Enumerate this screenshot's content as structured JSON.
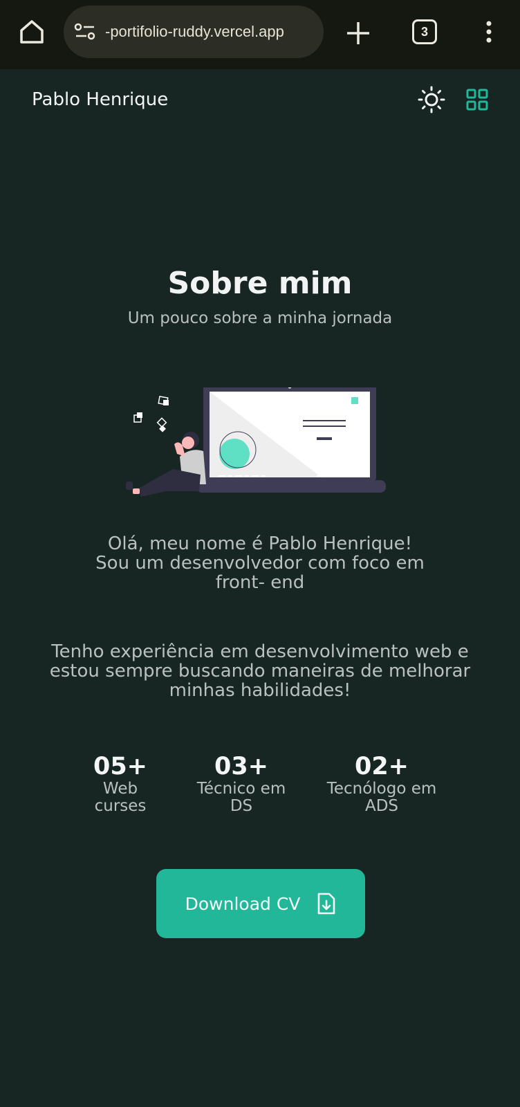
{
  "browser": {
    "url": "-portifolio-ruddy.vercel.app",
    "tab_count": "3",
    "icons": [
      "home-icon",
      "site-settings-icon",
      "plus-icon",
      "tabs-icon",
      "more-vert-icon"
    ]
  },
  "header": {
    "brand": "Pablo Henrique",
    "icons": [
      "sun-icon",
      "grid-icon"
    ]
  },
  "about": {
    "title": "Sobre mim",
    "subtitle": "Um pouco sobre a minha jornada",
    "intro_lines": [
      "Olá, meu nome é Pablo Henrique!",
      "Sou um desenvolvedor com foco em",
      "front- end"
    ],
    "experience": "Tenho experiência em desenvolvimento web e estou sempre buscando maneiras de melhorar minhas habilidades!",
    "stats": [
      {
        "number": "05+",
        "label": "Web curses"
      },
      {
        "number": "03+",
        "label": "Técnico em DS"
      },
      {
        "number": "02+",
        "label": "Tecnólogo em ADS"
      }
    ],
    "download_label": "Download CV",
    "download_icon": "file-download-icon"
  },
  "colors": {
    "page_bg": "#182623",
    "browser_bar": "#141811",
    "accent": "#21b798",
    "title_text": "#f1f4f3",
    "body_text": "#b9c1bf"
  }
}
